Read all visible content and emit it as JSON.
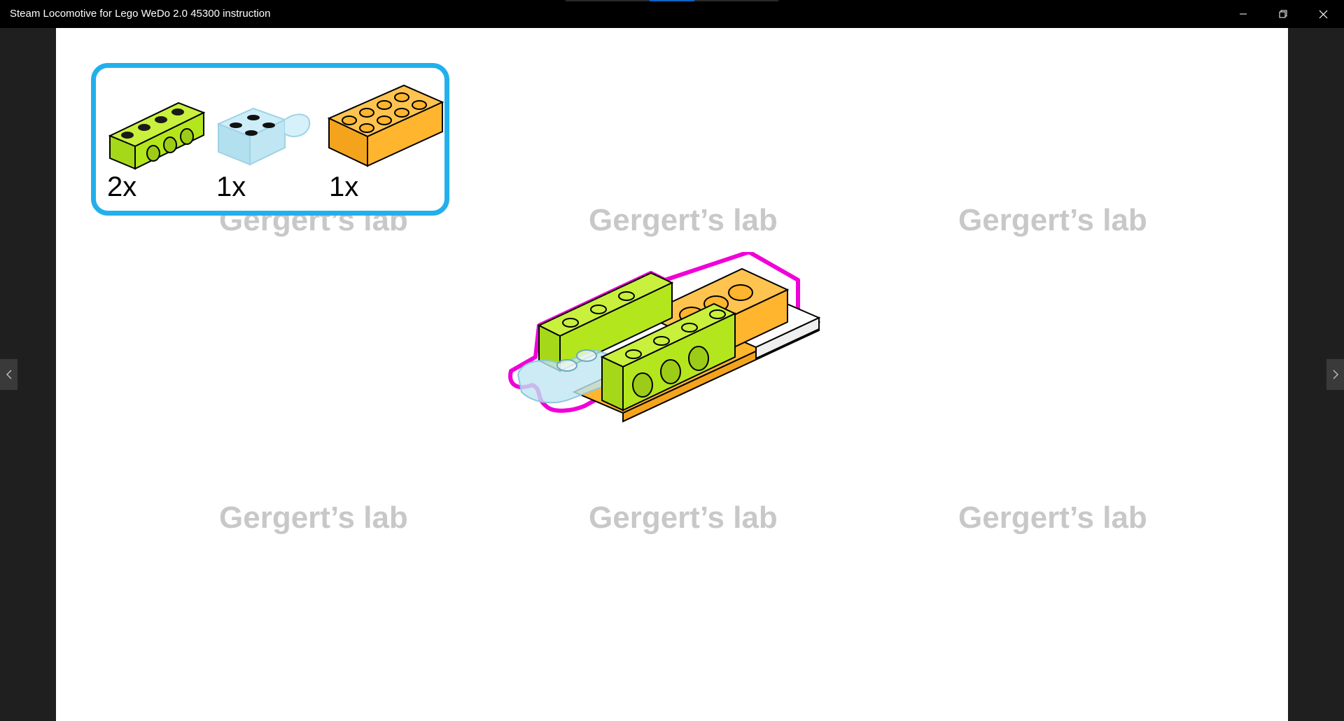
{
  "window": {
    "title": "Steam Locomotive for Lego WeDo 2.0 45300 instruction"
  },
  "watermark": {
    "text": "Gergert’s lab"
  },
  "parts": [
    {
      "name": "lime technic brick 1x4",
      "qty": "2x",
      "color": "#b4e61e"
    },
    {
      "name": "trans-light-blue plate with clip",
      "qty": "1x",
      "color": "#bfe6f2"
    },
    {
      "name": "orange brick 2x4",
      "qty": "1x",
      "color": "#ffb52e"
    }
  ],
  "colors": {
    "highlight": "#f000d8",
    "parts_border": "#22b0ec",
    "lime": "#b4e61e",
    "orange": "#ffb52e",
    "trans_blue": "#bfe6f2"
  },
  "icons": {
    "minimize": "minimize-icon",
    "restore": "restore-icon",
    "close": "close-icon",
    "prev": "chevron-left-icon",
    "next": "chevron-right-icon"
  }
}
